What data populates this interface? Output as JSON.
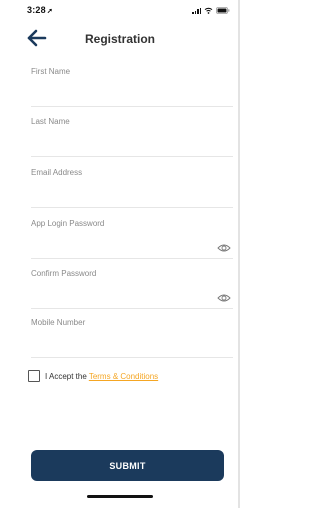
{
  "status_bar": {
    "time": "3:28",
    "location_glyph": "➚"
  },
  "nav": {
    "title": "Registration",
    "back_icon": "arrow-left-icon"
  },
  "form": {
    "first_name": {
      "label": "First Name",
      "value": ""
    },
    "last_name": {
      "label": "Last Name",
      "value": ""
    },
    "email": {
      "label": "Email Address",
      "value": ""
    },
    "password": {
      "label": "App Login Password",
      "value": ""
    },
    "confirm_password": {
      "label": "Confirm Password",
      "value": ""
    },
    "mobile": {
      "label": "Mobile Number",
      "value": ""
    }
  },
  "terms": {
    "prefix": "I Accept the",
    "link": "Terms & Conditions",
    "checked": false
  },
  "submit_label": "SUBMIT",
  "colors": {
    "accent": "#1b3a5c",
    "link": "#f5a623",
    "label": "#8a8a8a",
    "divider": "#e6e6e6"
  }
}
